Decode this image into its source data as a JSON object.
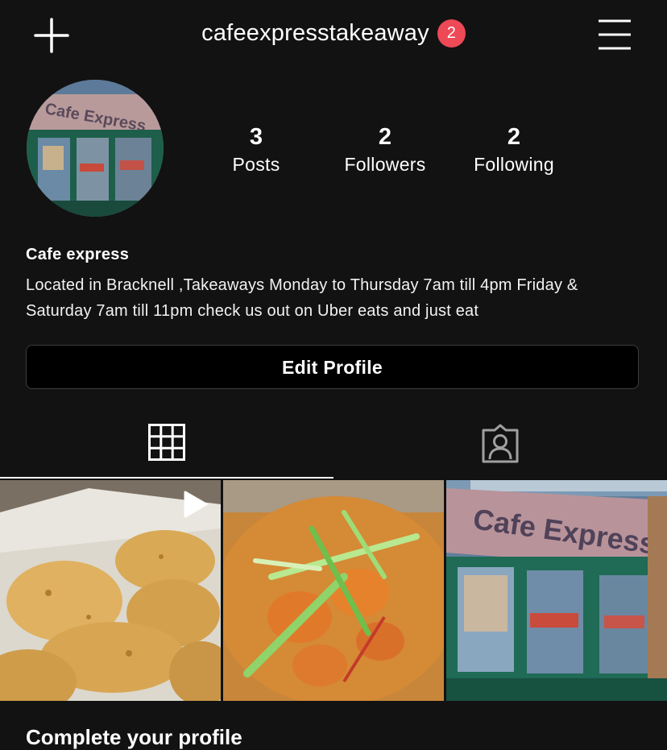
{
  "header": {
    "username": "cafeexpresstakeaway",
    "notification_count": "2"
  },
  "profile": {
    "display_name": "Cafe express",
    "bio": "Located in Bracknell ,Takeaways Monday to Thursday 7am till 4pm Friday & Saturday 7am till 11pm check us out on Uber eats and just eat",
    "avatar_sign_text": "Cafe Express"
  },
  "stats": [
    {
      "value": "3",
      "label": "Posts"
    },
    {
      "value": "2",
      "label": "Followers"
    },
    {
      "value": "2",
      "label": "Following"
    }
  ],
  "edit_profile_label": "Edit Profile",
  "tabs": [
    {
      "icon": "grid-icon",
      "active": true
    },
    {
      "icon": "tagged-person-icon",
      "active": false
    }
  ],
  "posts": [
    {
      "subject": "fried chicken fillets",
      "type": "video",
      "icon": "play-icon"
    },
    {
      "subject": "rice dish with spring onions"
    },
    {
      "subject": "cafe storefront",
      "sign_text": "Cafe Express"
    }
  ],
  "footer": {
    "partial_text": "Complete your profile"
  },
  "colors": {
    "background": "#121212",
    "badge": "#ed4956",
    "storefront_green": "#1f6b55"
  }
}
